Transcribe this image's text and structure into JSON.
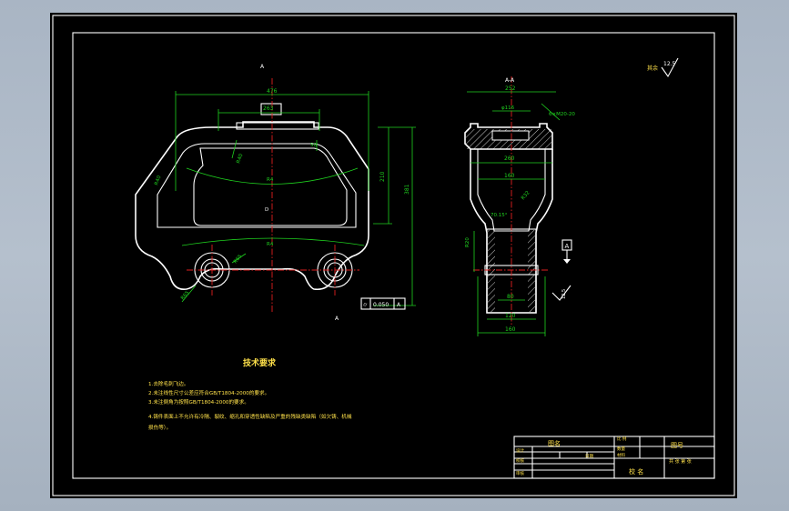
{
  "colors": {
    "background": "#a9b5c4",
    "sheet": "#000000",
    "outline": "#ffffff",
    "dimension": "#1fd21f",
    "centerline": "#e02020",
    "text": "#ffe14a"
  },
  "front_view": {
    "section_mark_top": "A",
    "section_mark_bottom": "A",
    "dim_overall_width": "476",
    "dim_top_width": "263",
    "dim_depth": "50",
    "dim_left_radius": "R40",
    "dim_right_radius": "R40",
    "dim_side": "R40",
    "dim_arc_upper": "R4",
    "dim_arc_inner": "R4",
    "dim_arc_lower": "R4",
    "dim_height_inner": "210",
    "dim_height_total": "381",
    "dim_hole": "R65",
    "dim_hole_left": "R65",
    "tolerance_frame": [
      "⌭",
      "0.050",
      "A"
    ],
    "datum_d": "D"
  },
  "section_view": {
    "title": "A-A",
    "dim_top": "252",
    "dim_bore": "φ116",
    "dim_slot": "6×M20-20",
    "dim_260": "260",
    "dim_160": "160",
    "dim_taper": "70.15°",
    "dim_width": "R32",
    "dim_bottom_1": "80",
    "dim_bottom_2": "120",
    "dim_bottom_3": "160",
    "dim_height_left": "R20",
    "datum_a": "A",
    "surface_mark": "12.5"
  },
  "roughness_note": {
    "label": "其余",
    "value": "12.5"
  },
  "tech_requirements": {
    "title": "技术要求",
    "items": [
      "1.去除毛刺飞边。",
      "2.未注线性尺寸公差应符合GB/T1804-2000的要求。",
      "3.未注倒角为按照GB/T1804-2000的要求。",
      "4.铸件表面上不允许有冷隔、裂纹、缩孔和穿透性缺陷及严重的残缺类缺陷（如欠铸、机械",
      "   损伤等）。"
    ]
  },
  "title_block": {
    "drawing_name": "图名",
    "scale_label": "比 例",
    "quantity_label": "数量",
    "material_label": "材料",
    "drawing_number": "图号",
    "designer": "设计",
    "checker": "校核",
    "reviewer": "审核",
    "date_label": "日期",
    "sheets": "共 张 第 张",
    "school": "校 名"
  }
}
